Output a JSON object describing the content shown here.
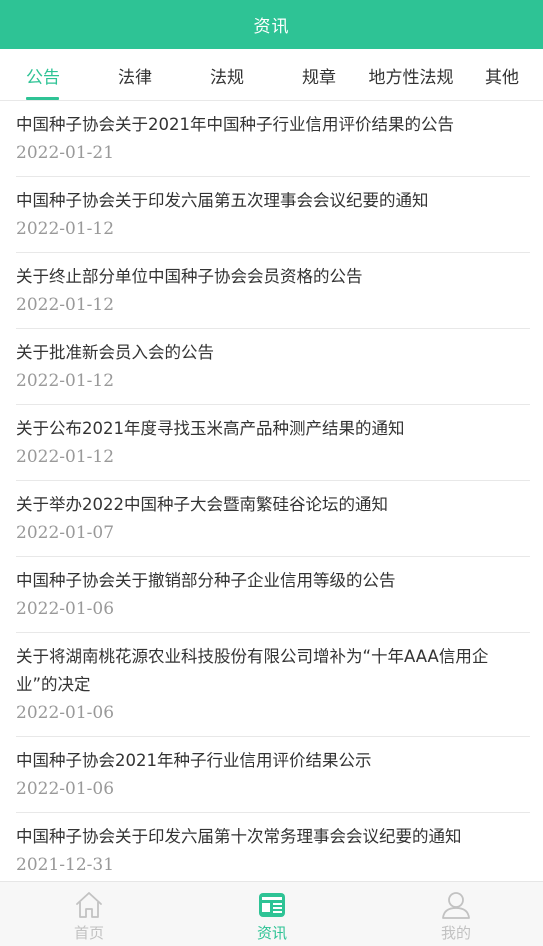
{
  "header": {
    "title": "资讯"
  },
  "tabs": [
    {
      "label": "公告",
      "active": true
    },
    {
      "label": "法律",
      "active": false
    },
    {
      "label": "法规",
      "active": false
    },
    {
      "label": "规章",
      "active": false
    },
    {
      "label": "地方性法规",
      "active": false
    },
    {
      "label": "其他",
      "active": false
    }
  ],
  "articles": [
    {
      "title": "中国种子协会关于2021年中国种子行业信用评价结果的公告",
      "date": "2022-01-21"
    },
    {
      "title": "中国种子协会关于印发六届第五次理事会会议纪要的通知",
      "date": "2022-01-12"
    },
    {
      "title": "关于终止部分单位中国种子协会会员资格的公告",
      "date": "2022-01-12"
    },
    {
      "title": "关于批准新会员入会的公告",
      "date": "2022-01-12"
    },
    {
      "title": "关于公布2021年度寻找玉米高产品种测产结果的通知",
      "date": "2022-01-12"
    },
    {
      "title": "关于举办2022中国种子大会暨南繁硅谷论坛的通知",
      "date": "2022-01-07"
    },
    {
      "title": "中国种子协会关于撤销部分种子企业信用等级的公告",
      "date": "2022-01-06"
    },
    {
      "title": "关于将湖南桃花源农业科技股份有限公司增补为“十年AAA信用企业”的决定",
      "date": "2022-01-06"
    },
    {
      "title": "中国种子协会2021年种子行业信用评价结果公示",
      "date": "2022-01-06"
    },
    {
      "title": "中国种子协会关于印发六届第十次常务理事会会议纪要的通知",
      "date": "2021-12-31"
    }
  ],
  "tabbar": [
    {
      "label": "首页",
      "icon": "home-icon",
      "active": false
    },
    {
      "label": "资讯",
      "icon": "news-icon",
      "active": true
    },
    {
      "label": "我的",
      "icon": "user-icon",
      "active": false
    }
  ],
  "colors": {
    "accent": "#2ec395",
    "text": "#333333",
    "date": "#999999",
    "inactive_tabbar": "#c2c2c2"
  }
}
